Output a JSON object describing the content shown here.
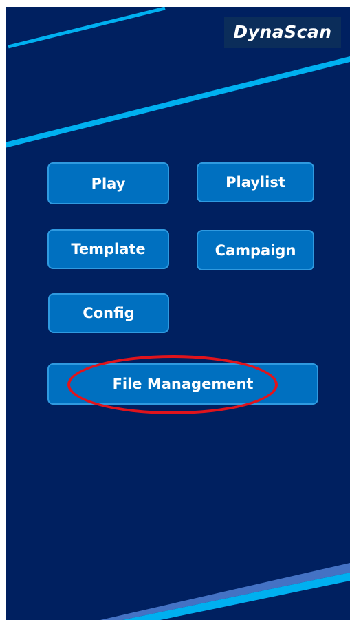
{
  "brand": {
    "name": "DynaScan"
  },
  "menu": {
    "play": "Play",
    "playlist": "Playlist",
    "template": "Template",
    "campaign": "Campaign",
    "config": "Config",
    "file_management": "File Management"
  },
  "colors": {
    "background": "#002060",
    "button_fill": "#0070c0",
    "button_border": "#2f9ae0",
    "accent_stripe": "#00b0f0",
    "accent_stripe_dark": "#4472c4",
    "highlight_ring": "#e0141c"
  }
}
